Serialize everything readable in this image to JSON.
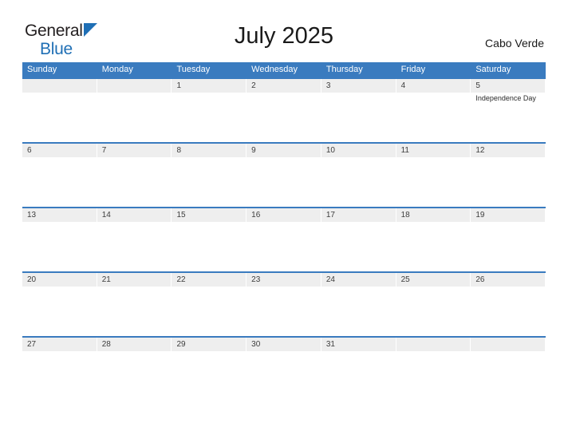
{
  "brand": {
    "name_part1": "General",
    "name_part2": "Blue",
    "flag_icon": "flag-triangle-icon",
    "accent_color": "#1f6fb5"
  },
  "header": {
    "title": "July 2025",
    "region": "Cabo Verde"
  },
  "calendar": {
    "month": "July",
    "year": "2025",
    "header_bg_color": "#3a7bbf",
    "day_band_color": "#eeeeee",
    "weekdays": [
      "Sunday",
      "Monday",
      "Tuesday",
      "Wednesday",
      "Thursday",
      "Friday",
      "Saturday"
    ],
    "weeks": [
      [
        {
          "date": "",
          "events": []
        },
        {
          "date": "",
          "events": []
        },
        {
          "date": "1",
          "events": []
        },
        {
          "date": "2",
          "events": []
        },
        {
          "date": "3",
          "events": []
        },
        {
          "date": "4",
          "events": []
        },
        {
          "date": "5",
          "events": [
            "Independence Day"
          ]
        }
      ],
      [
        {
          "date": "6",
          "events": []
        },
        {
          "date": "7",
          "events": []
        },
        {
          "date": "8",
          "events": []
        },
        {
          "date": "9",
          "events": []
        },
        {
          "date": "10",
          "events": []
        },
        {
          "date": "11",
          "events": []
        },
        {
          "date": "12",
          "events": []
        }
      ],
      [
        {
          "date": "13",
          "events": []
        },
        {
          "date": "14",
          "events": []
        },
        {
          "date": "15",
          "events": []
        },
        {
          "date": "16",
          "events": []
        },
        {
          "date": "17",
          "events": []
        },
        {
          "date": "18",
          "events": []
        },
        {
          "date": "19",
          "events": []
        }
      ],
      [
        {
          "date": "20",
          "events": []
        },
        {
          "date": "21",
          "events": []
        },
        {
          "date": "22",
          "events": []
        },
        {
          "date": "23",
          "events": []
        },
        {
          "date": "24",
          "events": []
        },
        {
          "date": "25",
          "events": []
        },
        {
          "date": "26",
          "events": []
        }
      ],
      [
        {
          "date": "27",
          "events": []
        },
        {
          "date": "28",
          "events": []
        },
        {
          "date": "29",
          "events": []
        },
        {
          "date": "30",
          "events": []
        },
        {
          "date": "31",
          "events": []
        },
        {
          "date": "",
          "events": []
        },
        {
          "date": "",
          "events": []
        }
      ]
    ]
  }
}
